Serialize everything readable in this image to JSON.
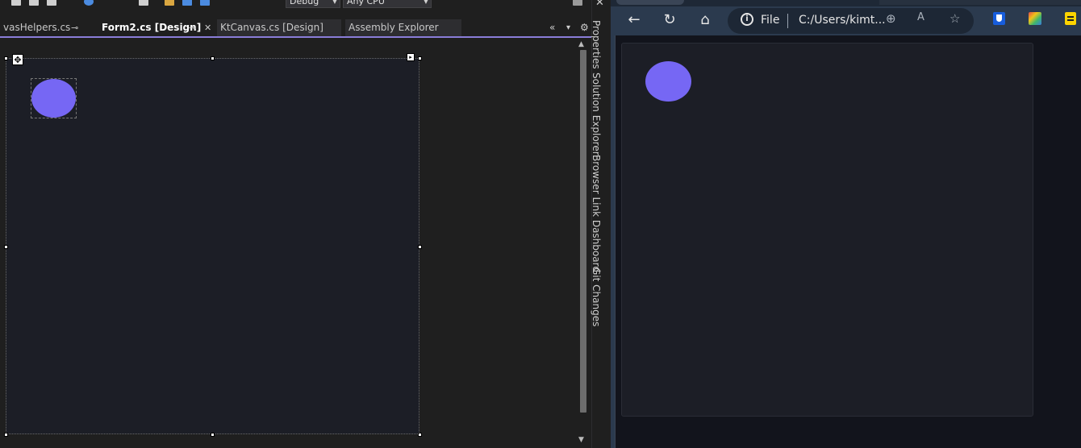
{
  "vs": {
    "toolbar": {
      "config_combo": "Debug",
      "platform_combo": "Any CPU"
    },
    "tabs": [
      {
        "label": "vasHelpers.cs"
      },
      {
        "label": "Form2.cs [Design]"
      },
      {
        "label": "KtCanvas.cs [Design]"
      },
      {
        "label": "Assembly Explorer"
      }
    ],
    "side_rail": [
      "Properties",
      "Solution Explorer",
      "Browser Link Dashboard",
      "Git Changes"
    ],
    "designer": {
      "shape_color": "#7667f4",
      "form_bg": "#1c1e26"
    }
  },
  "browser": {
    "address": {
      "scheme_label": "File",
      "url": "C:/Users/kimt..."
    },
    "icons": [
      "back-icon",
      "refresh-icon",
      "home-icon",
      "info-icon",
      "zoom-icon",
      "read-aloud-icon",
      "favorite-icon",
      "bitwarden-extension-icon",
      "colorful-extension-icon",
      "yellow-extension-icon"
    ],
    "page": {
      "shape_color": "#7667f4"
    }
  },
  "colors": {
    "accent": "#8a7dd8",
    "ellipse": "#7667f4"
  }
}
